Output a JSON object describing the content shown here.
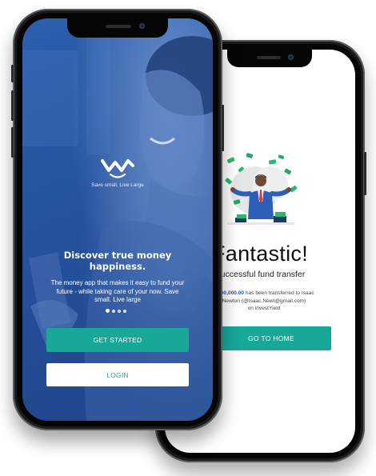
{
  "onboarding_screen": {
    "tagline": "Save small. Live Large",
    "headline": "Discover true money happiness.",
    "body": "The money app that makes it easy to fund your future - while taking care of your now. Save small. Live large",
    "pagination": {
      "total": 4,
      "active": 1
    },
    "get_started_label": "GET STARTED",
    "login_label": "LOGIN"
  },
  "success_screen": {
    "title": "Fantastic!",
    "subtitle": "Successful fund transfer",
    "message_amount": "₦100,000.00",
    "message_line1": " has been transferred to Isaac",
    "message_line2": "Newton (@Isaac.Newt@gmail.com)",
    "message_line3": "on investYield",
    "go_home_label": "GO TO HOME"
  },
  "colors": {
    "accent": "#17a898",
    "onboarding_bg": "#2c5fae",
    "amount": "#2a55a8"
  },
  "icons": [
    "app-logo-icon",
    "money-celebration-illustration"
  ]
}
